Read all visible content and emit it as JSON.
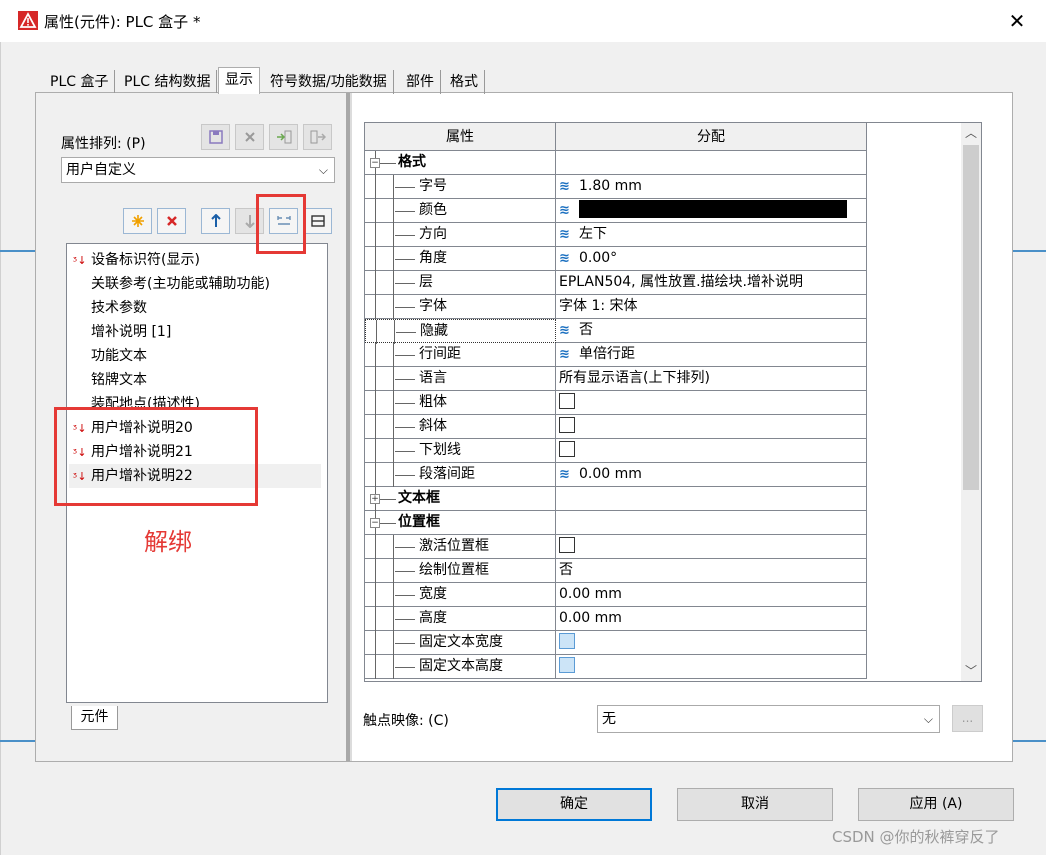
{
  "window": {
    "title": "属性(元件): PLC 盒子 *",
    "close_glyph": "✕"
  },
  "tabs": [
    {
      "label": "PLC 盒子"
    },
    {
      "label": "PLC 结构数据"
    },
    {
      "label": "显示"
    },
    {
      "label": "符号数据/功能数据"
    },
    {
      "label": "部件"
    },
    {
      "label": "格式"
    }
  ],
  "left": {
    "order_label": "属性排列: (P)",
    "order_value": "用户自定义",
    "list_items": [
      {
        "label": "设备标识符(显示)",
        "icon": true
      },
      {
        "label": "关联参考(主功能或辅助功能)",
        "icon": false
      },
      {
        "label": "技术参数",
        "icon": false
      },
      {
        "label": "增补说明 [1]",
        "icon": false
      },
      {
        "label": "功能文本",
        "icon": false
      },
      {
        "label": "铭牌文本",
        "icon": false
      },
      {
        "label": "装配地点(描述性)",
        "icon": false
      },
      {
        "label": "用户增补说明20",
        "icon": true
      },
      {
        "label": "用户增补说明21",
        "icon": true
      },
      {
        "label": "用户增补说明22",
        "icon": true
      }
    ],
    "list_tab": "元件",
    "annotation": "解绑"
  },
  "grid": {
    "headers": [
      "属性",
      "分配"
    ],
    "rows": [
      {
        "label": "格式",
        "group": true,
        "value": ""
      },
      {
        "label": "字号",
        "value": "1.80 mm",
        "layers": true
      },
      {
        "label": "颜色",
        "value": "",
        "layers": true,
        "black": true
      },
      {
        "label": "方向",
        "value": "左下",
        "layers": true
      },
      {
        "label": "角度",
        "value": "0.00°",
        "layers": true
      },
      {
        "label": "层",
        "value": "EPLAN504, 属性放置.描绘块.增补说明"
      },
      {
        "label": "字体",
        "value": "字体 1: 宋体"
      },
      {
        "label": "隐藏",
        "value": "否",
        "layers": true,
        "focus": true
      },
      {
        "label": "行间距",
        "value": "单倍行距",
        "layers": true
      },
      {
        "label": "语言",
        "value": "所有显示语言(上下排列)"
      },
      {
        "label": "粗体",
        "value": "",
        "check": true
      },
      {
        "label": "斜体",
        "value": "",
        "check": true
      },
      {
        "label": "下划线",
        "value": "",
        "check": true
      },
      {
        "label": "段落间距",
        "value": "0.00 mm",
        "layers": true
      },
      {
        "label": "文本框",
        "group": true,
        "collapsed": true,
        "value": ""
      },
      {
        "label": "位置框",
        "group": true,
        "value": ""
      },
      {
        "label": "激活位置框",
        "value": "",
        "check": true
      },
      {
        "label": "绘制位置框",
        "value": "否"
      },
      {
        "label": "宽度",
        "value": "0.00 mm"
      },
      {
        "label": "高度",
        "value": "0.00 mm"
      },
      {
        "label": "固定文本宽度",
        "value": "",
        "check": true,
        "check_blue": true
      },
      {
        "label": "固定文本高度",
        "value": "",
        "check": true,
        "check_blue": true
      }
    ]
  },
  "contact": {
    "label": "触点映像: (C)",
    "value": "无",
    "dots": "..."
  },
  "buttons": {
    "ok": "确定",
    "cancel": "取消",
    "apply": "应用 (A)"
  },
  "watermark": "CSDN @你的秋裤穿反了"
}
